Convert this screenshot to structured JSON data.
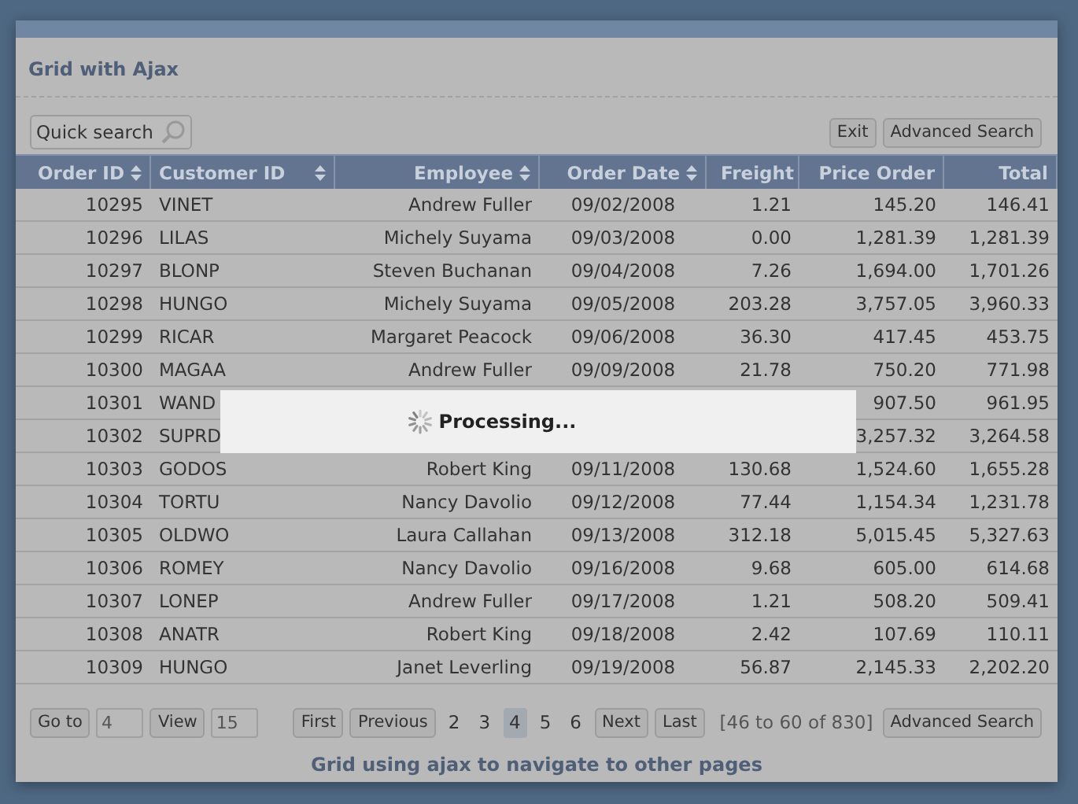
{
  "panel": {
    "title": "Grid with Ajax"
  },
  "toolbar": {
    "search": {
      "placeholder": "Quick search"
    },
    "buttons": [
      "Exit",
      "Advanced Search"
    ]
  },
  "table": {
    "columns": [
      {
        "label": "Order ID",
        "sortable": true
      },
      {
        "label": "Customer ID",
        "sortable": true
      },
      {
        "label": "Employee",
        "sortable": true
      },
      {
        "label": "Order Date",
        "sortable": true
      },
      {
        "label": "Freight",
        "sortable": false
      },
      {
        "label": "Price Order",
        "sortable": false
      },
      {
        "label": "Total",
        "sortable": false
      }
    ],
    "rows": [
      [
        "10295",
        "VINET",
        "Andrew Fuller",
        "09/02/2008",
        "1.21",
        "145.20",
        "146.41"
      ],
      [
        "10296",
        "LILAS",
        "Michely Suyama",
        "09/03/2008",
        "0.00",
        "1,281.39",
        "1,281.39"
      ],
      [
        "10297",
        "BLONP",
        "Steven Buchanan",
        "09/04/2008",
        "7.26",
        "1,694.00",
        "1,701.26"
      ],
      [
        "10298",
        "HUNGO",
        "Michely Suyama",
        "09/05/2008",
        "203.28",
        "3,757.05",
        "3,960.33"
      ],
      [
        "10299",
        "RICAR",
        "Margaret Peacock",
        "09/06/2008",
        "36.30",
        "417.45",
        "453.75"
      ],
      [
        "10300",
        "MAGAA",
        "Andrew Fuller",
        "09/09/2008",
        "21.78",
        "750.20",
        "771.98"
      ],
      [
        "10301",
        "WAND",
        null,
        null,
        null,
        "907.50",
        "961.95"
      ],
      [
        "10302",
        "SUPRD",
        null,
        null,
        null,
        "3,257.32",
        "3,264.58"
      ],
      [
        "10303",
        "GODOS",
        "Robert King",
        "09/11/2008",
        "130.68",
        "1,524.60",
        "1,655.28"
      ],
      [
        "10304",
        "TORTU",
        "Nancy Davolio",
        "09/12/2008",
        "77.44",
        "1,154.34",
        "1,231.78"
      ],
      [
        "10305",
        "OLDWO",
        "Laura Callahan",
        "09/13/2008",
        "312.18",
        "5,015.45",
        "5,327.63"
      ],
      [
        "10306",
        "ROMEY",
        "Nancy Davolio",
        "09/16/2008",
        "9.68",
        "605.00",
        "614.68"
      ],
      [
        "10307",
        "LONEP",
        "Andrew Fuller",
        "09/17/2008",
        "1.21",
        "508.20",
        "509.41"
      ],
      [
        "10308",
        "ANATR",
        "Robert King",
        "09/18/2008",
        "2.42",
        "107.69",
        "110.11"
      ],
      [
        "10309",
        "HUNGO",
        "Janet Leverling",
        "09/19/2008",
        "56.87",
        "2,145.33",
        "2,202.20"
      ]
    ]
  },
  "processing": {
    "label": "Processing..."
  },
  "pager": {
    "goto_button": "Go to",
    "goto_value": "4",
    "view_button": "View",
    "view_value": "15",
    "first": "First",
    "previous": "Previous",
    "pages": [
      {
        "label": "2",
        "selected": false
      },
      {
        "label": "3",
        "selected": false
      },
      {
        "label": "4",
        "selected": true
      },
      {
        "label": "5",
        "selected": false
      },
      {
        "label": "6",
        "selected": false
      }
    ],
    "next": "Next",
    "last": "Last",
    "range": "[46 to 60 of 830]",
    "advanced_button": "Advanced Search"
  },
  "caption": "Grid using ajax to navigate to other pages"
}
